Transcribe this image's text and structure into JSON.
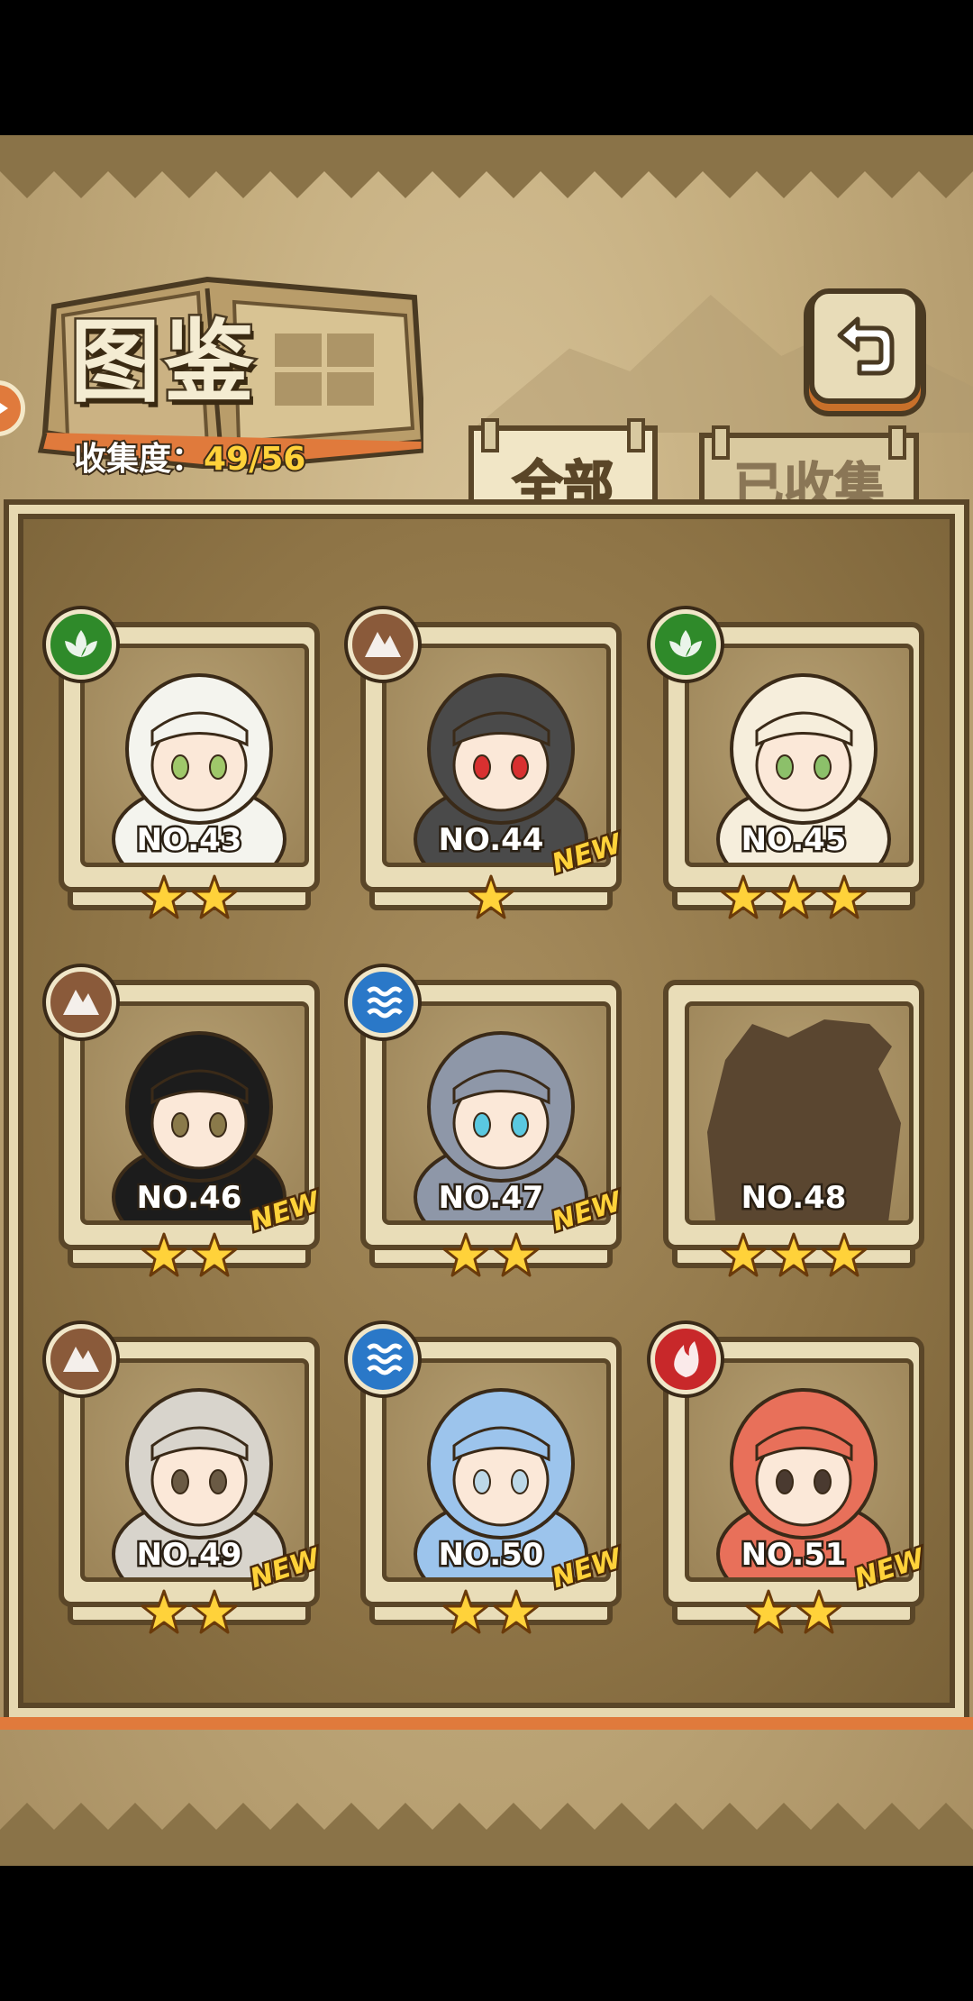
{
  "header": {
    "title": "图鉴",
    "collection_label": "收集度：",
    "collection_value": "49/56"
  },
  "tabs": [
    {
      "label": "全部",
      "active": true
    },
    {
      "label": "已收集",
      "active": false
    }
  ],
  "colors": {
    "grass": "#2f8a2a",
    "earth": "#8a5a3a",
    "water": "#2a78c8",
    "fire": "#c8282a",
    "star": "#ffd23a",
    "accent_orange": "#e07a3c"
  },
  "cards": [
    {
      "no": "NO.43",
      "element": "grass-icon",
      "stars": 2,
      "new": false,
      "locked": false,
      "palette": [
        "#f4f4ee",
        "#9fc86a"
      ]
    },
    {
      "no": "NO.44",
      "element": "earth-icon",
      "stars": 1,
      "new": true,
      "new_label": "NEW",
      "locked": false,
      "palette": [
        "#4a4a4a",
        "#d83030"
      ]
    },
    {
      "no": "NO.45",
      "element": "grass-icon",
      "stars": 3,
      "new": false,
      "locked": false,
      "palette": [
        "#f6eedc",
        "#8cc06a"
      ]
    },
    {
      "no": "NO.46",
      "element": "earth-icon",
      "stars": 2,
      "new": true,
      "new_label": "NEW",
      "locked": false,
      "palette": [
        "#1c1c1c",
        "#8a7a4a"
      ]
    },
    {
      "no": "NO.47",
      "element": "water-icon",
      "stars": 2,
      "new": true,
      "new_label": "NEW",
      "locked": false,
      "palette": [
        "#8e97a8",
        "#5ac8e0"
      ]
    },
    {
      "no": "NO.48",
      "element": null,
      "stars": 3,
      "new": false,
      "locked": true,
      "palette": [
        "#5a4630",
        "#5a4630"
      ]
    },
    {
      "no": "NO.49",
      "element": "earth-icon",
      "stars": 2,
      "new": true,
      "new_label": "NEW",
      "locked": false,
      "palette": [
        "#d8d4cc",
        "#6a5a44"
      ]
    },
    {
      "no": "NO.50",
      "element": "water-icon",
      "stars": 2,
      "new": true,
      "new_label": "NEW",
      "locked": false,
      "palette": [
        "#9cc4ec",
        "#bcd8e8"
      ]
    },
    {
      "no": "NO.51",
      "element": "fire-icon",
      "stars": 2,
      "new": true,
      "new_label": "NEW",
      "locked": false,
      "palette": [
        "#e8705a",
        "#4a3a30"
      ]
    }
  ]
}
